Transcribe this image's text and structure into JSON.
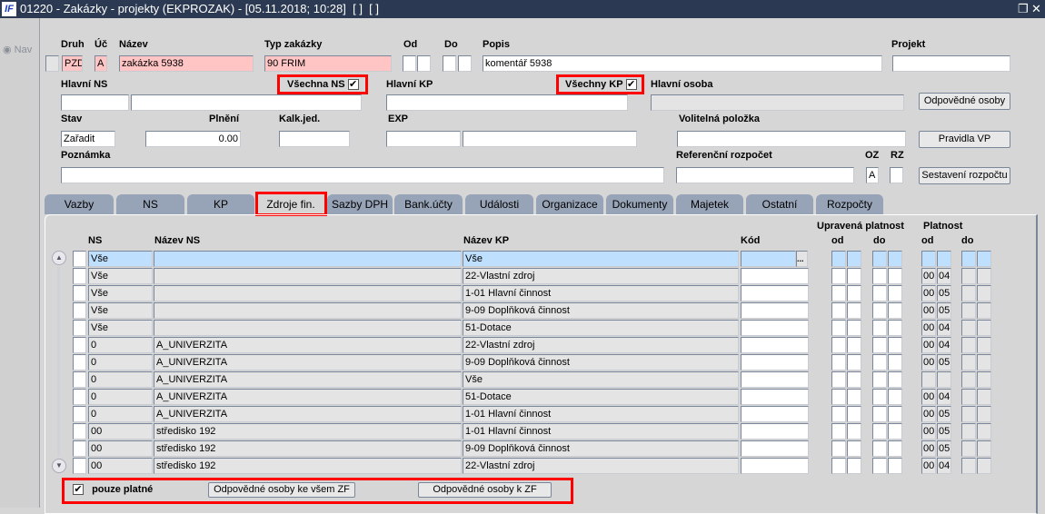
{
  "window": {
    "logo": "IF",
    "title": "01220 - Zakázky - projekty (EKPROZAK) - [05.11.2018; 10:28]  [ ]  [ ]",
    "restore_icon": "❐",
    "close_icon": "✕"
  },
  "nav": {
    "label": "Nav"
  },
  "form": {
    "druh_label": "Druh",
    "druh": "PZD",
    "uc_label": "Úč",
    "uc": "A",
    "nazev_label": "Název",
    "nazev": "zakázka 5938",
    "typ_label": "Typ zakázky",
    "typ": "90 FRIM",
    "od_label": "Od",
    "do_label": "Do",
    "popis_label": "Popis",
    "popis": "komentář 5938",
    "projekt_label": "Projekt",
    "hlavni_ns_label": "Hlavní NS",
    "vsechna_ns_label": "Všechna NS",
    "vsechna_ns_checked": true,
    "hlavni_kp_label": "Hlavní KP",
    "vsechny_kp_label": "Všechny KP",
    "vsechny_kp_checked": true,
    "hlavni_osoba_label": "Hlavní osoba",
    "stav_label": "Stav",
    "stav": "Zařadit",
    "plneni_label": "Plnění",
    "plneni": "0.00",
    "kalk_label": "Kalk.jed.",
    "exp_label": "EXP",
    "volitelna_label": "Volitelná položka",
    "poznamka_label": "Poznámka",
    "ref_label": "Referenční rozpočet",
    "oz_label": "OZ",
    "oz": "A",
    "rz_label": "RZ",
    "btn_odpovedne": "Odpovědné osoby",
    "btn_pravidla": "Pravidla VP",
    "btn_sestaveni": "Sestavení rozpočtu"
  },
  "tabs": [
    "Vazby",
    "NS",
    "KP",
    "Zdroje fin.",
    "Sazby DPH",
    "Bank.účty",
    "Události",
    "Organizace",
    "Dokumenty",
    "Majetek",
    "Ostatní",
    "Rozpočty"
  ],
  "active_tab": "Zdroje fin.",
  "grid": {
    "headers": {
      "ns": "NS",
      "nazev_ns": "Název NS",
      "nazev_kp": "Název KP",
      "kod": "Kód",
      "upravena": "Upravená platnost",
      "platnost": "Platnost",
      "od": "od",
      "do": "do"
    },
    "rows": [
      {
        "ns": "Vše",
        "nazev_ns": "",
        "nazev_kp": "Vše",
        "plat_od": [
          "",
          ""
        ]
      },
      {
        "ns": "Vše",
        "nazev_ns": "",
        "nazev_kp": "22-Vlastní zdroj",
        "plat_od": [
          "00",
          "04"
        ]
      },
      {
        "ns": "Vše",
        "nazev_ns": "",
        "nazev_kp": "1-01 Hlavní činnost",
        "plat_od": [
          "00",
          "05"
        ]
      },
      {
        "ns": "Vše",
        "nazev_ns": "",
        "nazev_kp": "9-09 Doplňková činnost",
        "plat_od": [
          "00",
          "05"
        ]
      },
      {
        "ns": "Vše",
        "nazev_ns": "",
        "nazev_kp": "51-Dotace",
        "plat_od": [
          "00",
          "04"
        ]
      },
      {
        "ns": "0",
        "nazev_ns": "A_UNIVERZITA",
        "nazev_kp": "22-Vlastní zdroj",
        "plat_od": [
          "00",
          "04"
        ]
      },
      {
        "ns": "0",
        "nazev_ns": "A_UNIVERZITA",
        "nazev_kp": "9-09 Doplňková činnost",
        "plat_od": [
          "00",
          "05"
        ]
      },
      {
        "ns": "0",
        "nazev_ns": "A_UNIVERZITA",
        "nazev_kp": "Vše",
        "plat_od": [
          "",
          ""
        ]
      },
      {
        "ns": "0",
        "nazev_ns": "A_UNIVERZITA",
        "nazev_kp": "51-Dotace",
        "plat_od": [
          "00",
          "04"
        ]
      },
      {
        "ns": "0",
        "nazev_ns": "A_UNIVERZITA",
        "nazev_kp": "1-01 Hlavní činnost",
        "plat_od": [
          "00",
          "05"
        ]
      },
      {
        "ns": "00",
        "nazev_ns": "středisko 192",
        "nazev_kp": "1-01 Hlavní činnost",
        "plat_od": [
          "00",
          "05"
        ]
      },
      {
        "ns": "00",
        "nazev_ns": "středisko 192",
        "nazev_kp": "9-09 Doplňková činnost",
        "plat_od": [
          "00",
          "05"
        ]
      },
      {
        "ns": "00",
        "nazev_ns": "středisko 192",
        "nazev_kp": "22-Vlastní zdroj",
        "plat_od": [
          "00",
          "04"
        ]
      }
    ],
    "lov_button": "...",
    "pouze_platne_label": "pouze platné",
    "pouze_platne_checked": true,
    "btn_all_zf": "Odpovědné osoby ke všem ZF",
    "btn_zf": "Odpovědné osoby k ZF"
  }
}
